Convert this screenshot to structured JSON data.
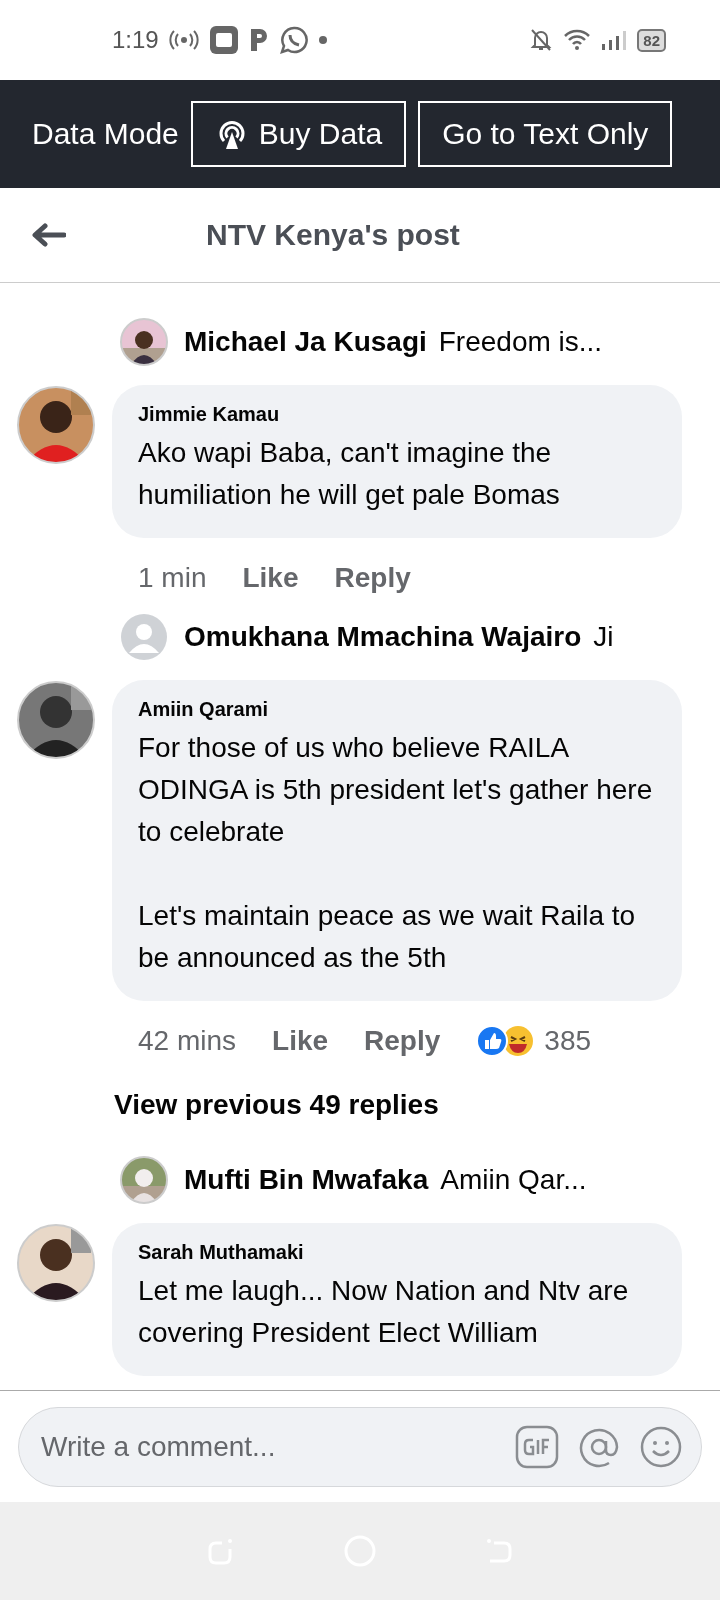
{
  "status_bar": {
    "time": "1:19",
    "battery": "82"
  },
  "data_bar": {
    "label": "Data Mode",
    "buttons": [
      {
        "kind": "buy",
        "label": "Buy Data"
      },
      {
        "kind": "text",
        "label": "Go to Text Only"
      }
    ]
  },
  "header": {
    "title": "NTV Kenya's post"
  },
  "items": [
    {
      "kind": "reply_preview",
      "photo": true,
      "name": "Michael Ja Kusagi",
      "snippet": "Freedom is..."
    },
    {
      "kind": "comment",
      "photo": true,
      "name": "Jimmie Kamau",
      "text": "Ako wapi Baba, can't imagine the humiliation he will get pale Bomas",
      "time": "1 min",
      "like": "Like",
      "reply": "Reply"
    },
    {
      "kind": "reply_preview",
      "photo": false,
      "name": "Omukhana Mmachina Wajairo",
      "snippet": "Ji"
    },
    {
      "kind": "comment",
      "photo": true,
      "name": "Amiin Qarami",
      "text": "For those of us who believe RAILA ODINGA is 5th president let's gather here to celebrate\n\nLet's maintain peace as we wait Raila to be announced as the 5th",
      "time": "42 mins",
      "like": "Like",
      "reply": "Reply",
      "reactions": "385"
    },
    {
      "kind": "view_more",
      "label": "View previous 49 replies"
    },
    {
      "kind": "reply_preview",
      "photo": true,
      "name": "Mufti Bin Mwafaka",
      "snippet": "Amiin Qar..."
    },
    {
      "kind": "comment",
      "photo": true,
      "name": "Sarah Muthamaki",
      "text": "Let me laugh... Now Nation and Ntv are covering President Elect William"
    }
  ],
  "composer": {
    "placeholder": "Write a comment..."
  }
}
